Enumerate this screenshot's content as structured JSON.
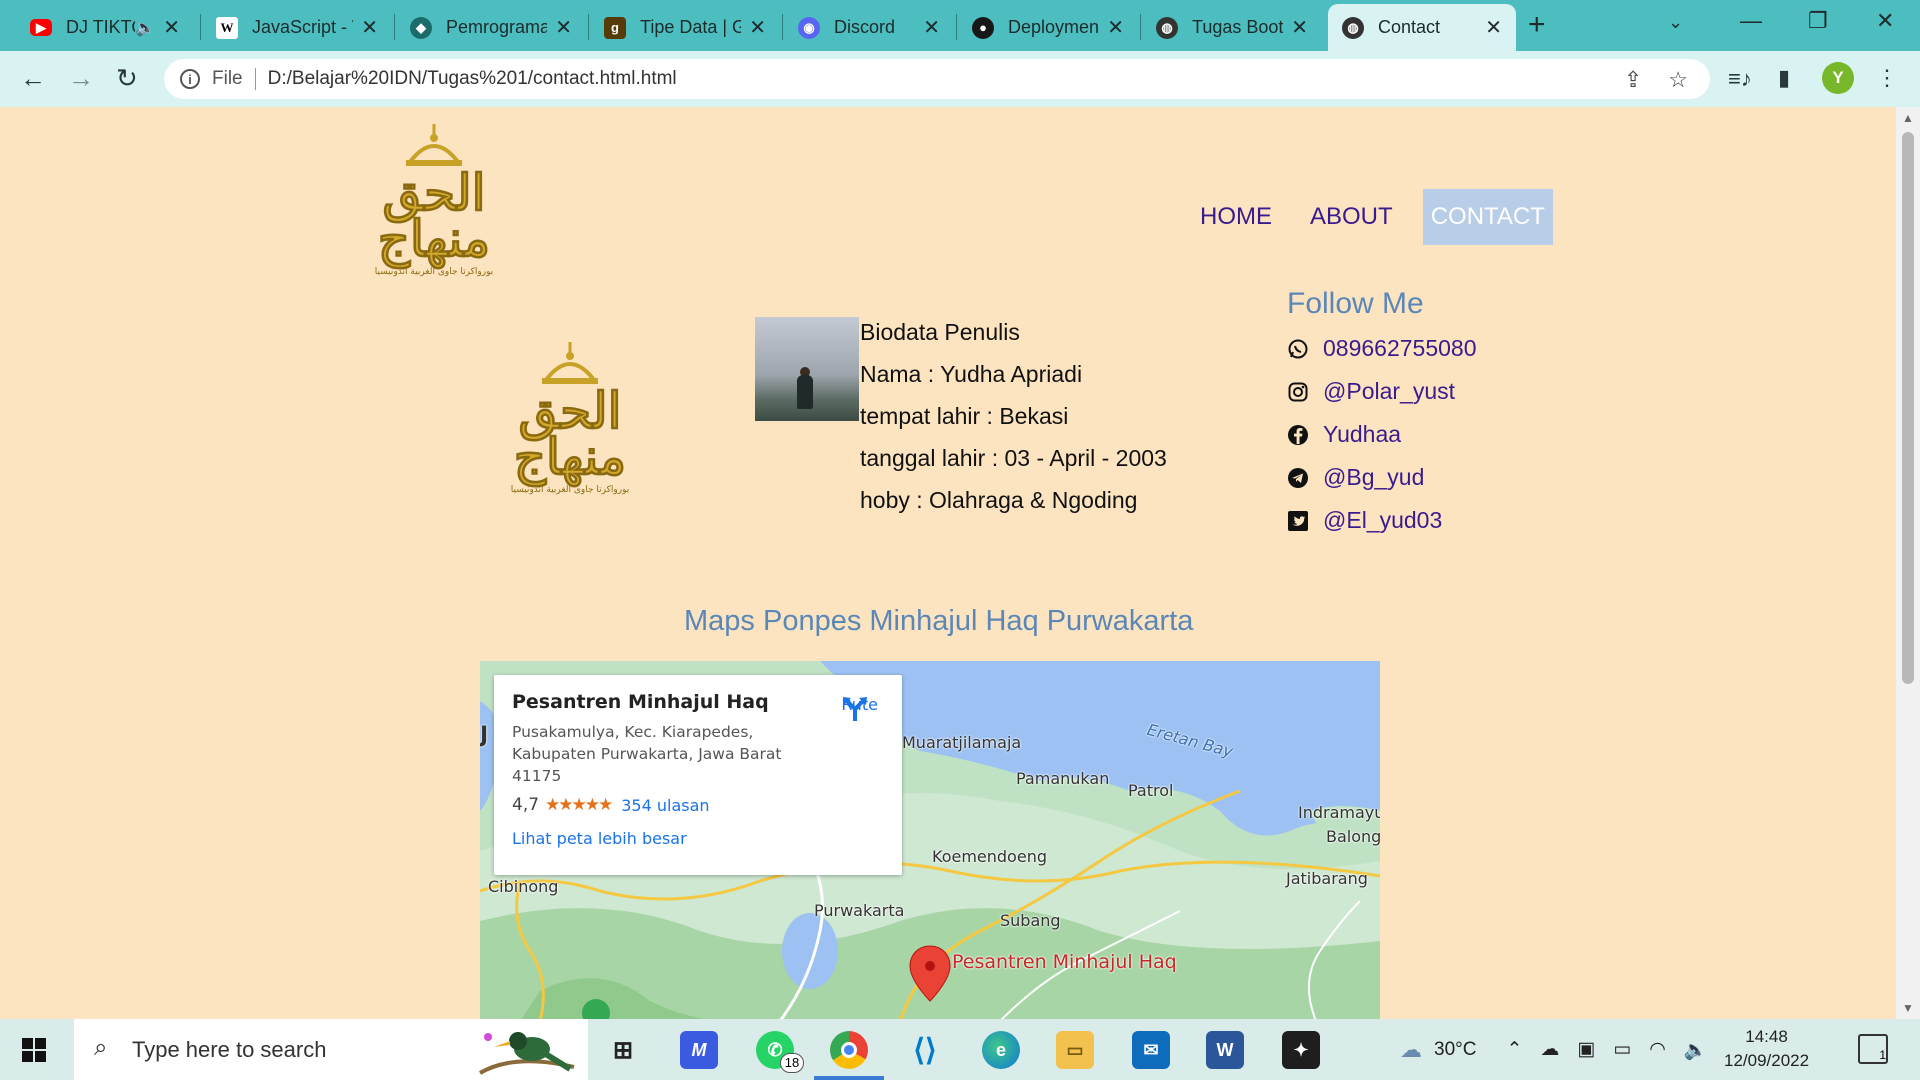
{
  "browser": {
    "tabs": [
      {
        "title": "DJ TIKTOK",
        "icon": "youtube-icon",
        "color": "#ff0000",
        "muted_icon": "speaker-icon"
      },
      {
        "title": "JavaScript - Wikipedia",
        "icon": "wikipedia-icon",
        "color": "#ffffff"
      },
      {
        "title": "Pemrograman",
        "icon": "site-icon",
        "color": "#1b6b6b"
      },
      {
        "title": "Tipe Data | Goodreads",
        "icon": "goodreads-icon",
        "color": "#553b08"
      },
      {
        "title": "Discord",
        "icon": "discord-icon",
        "color": "#5865f2"
      },
      {
        "title": "Deployment",
        "icon": "github-icon",
        "color": "#181717"
      },
      {
        "title": "Tugas Bootstrap",
        "icon": "globe-icon",
        "color": "#333333"
      },
      {
        "title": "Contact",
        "icon": "globe-icon",
        "color": "#333333",
        "active": true
      }
    ],
    "url_label": "File",
    "url": "D:/Belajar%20IDN/Tugas%201/contact.html.html",
    "profile_initial": "Y"
  },
  "site": {
    "logo_text_top": "الحق",
    "logo_text_bottom": "منهاج",
    "logo_caption": "بورواكرتا جاوى الغربية اندونيسيا",
    "nav": [
      {
        "label": "HOME",
        "active": false
      },
      {
        "label": "ABOUT",
        "active": false
      },
      {
        "label": "CONTACT",
        "active": true
      }
    ],
    "bio": {
      "heading": "Biodata Penulis",
      "name": "Nama : Yudha Apriadi",
      "birthplace": "tempat lahir : Bekasi",
      "birthdate": "tanggal lahir : 03 - April - 2003",
      "hobby": "hoby : Olahraga & Ngoding"
    },
    "follow": {
      "title": "Follow Me",
      "items": [
        {
          "icon": "whatsapp-icon",
          "label": "089662755080"
        },
        {
          "icon": "instagram-icon",
          "label": "@Polar_yust"
        },
        {
          "icon": "facebook-icon",
          "label": "Yudhaa"
        },
        {
          "icon": "telegram-icon",
          "label": "@Bg_yud"
        },
        {
          "icon": "twitter-icon",
          "label": "@El_yud03"
        }
      ]
    },
    "maps_title": "Maps Ponpes Minhajul Haq Purwakarta",
    "map": {
      "place_name": "Pesantren Minhajul Haq",
      "address": "Pusakamulya, Kec. Kiarapedes, Kabupaten Purwakarta, Jawa Barat 41175",
      "rating": "4,7",
      "stars": "★★★★★",
      "reviews": "354 ulasan",
      "larger_map": "Lihat peta lebih besar",
      "route": "Rute",
      "labels": {
        "muaratjilamaja": "Muaratjilamaja",
        "eretan_bay": "Eretan Bay",
        "pamanukan": "Pamanukan",
        "patrol": "Patrol",
        "indramayu": "Indramayu",
        "balong": "Balong",
        "koemendoeng": "Koemendoeng",
        "jatibarang": "Jatibarang",
        "cibinong": "Cibinong",
        "purwakarta": "Purwakarta",
        "subang": "Subang",
        "pin_label": "Pesantren Minhajul Haq",
        "edge_letter": "J"
      }
    }
  },
  "taskbar": {
    "search_placeholder": "Type here to search",
    "whatsapp_badge": "18",
    "weather": "30°C",
    "time": "14:48",
    "date": "12/09/2022",
    "notifications": "1"
  }
}
